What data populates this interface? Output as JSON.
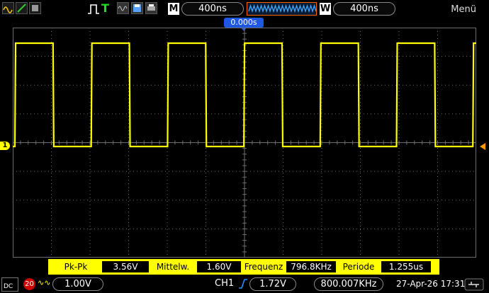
{
  "top": {
    "mode_icon": "waveform-display-icon",
    "timebase_letter": "M",
    "timebase_value": "400ns",
    "window_letter": "W",
    "window_value": "400ns",
    "menu_label": "Menü"
  },
  "trigger": {
    "time_position": "0.000s"
  },
  "measurements": {
    "pkpk_label": "Pk-Pk",
    "pkpk_value": "3.56V",
    "mean_label": "Mittelw.",
    "mean_value": "1.60V",
    "freq_label": "Frequenz",
    "freq_value": "796.8KHz",
    "period_label": "Periode",
    "period_value": "1.255us"
  },
  "bottom": {
    "coupling": "DC",
    "bw_limit": "20",
    "ch1_scale": "1.00V",
    "trigger_channel": "CH1",
    "trigger_level": "1.72V",
    "trigger_frequency": "800.007KHz",
    "timestamp": "27-Apr-26 17:31"
  },
  "colors": {
    "trace": "#ffff00",
    "grid": "#6e6e6e",
    "accent": "#1f58e0",
    "menu_hl": "#ff6600"
  }
}
